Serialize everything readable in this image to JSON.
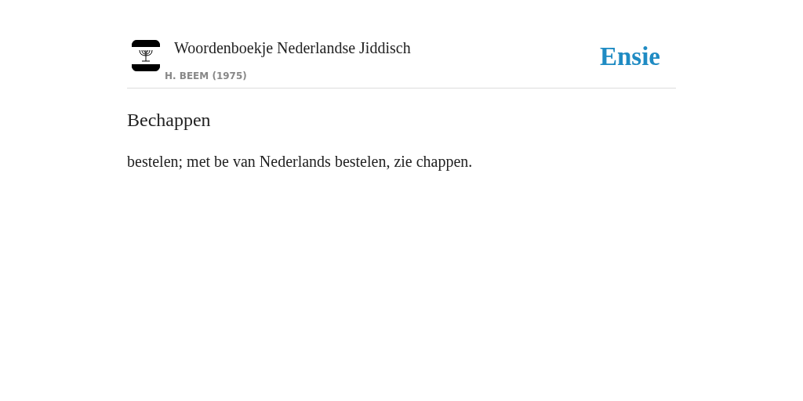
{
  "header": {
    "title": "Woordenboekje Nederlandse Jiddisch",
    "author": "H. BEEM (1975)",
    "brand": "Ensie"
  },
  "entry": {
    "term": "Bechappen",
    "definition": "bestelen; met be van Nederlands bestelen, zie chappen."
  }
}
